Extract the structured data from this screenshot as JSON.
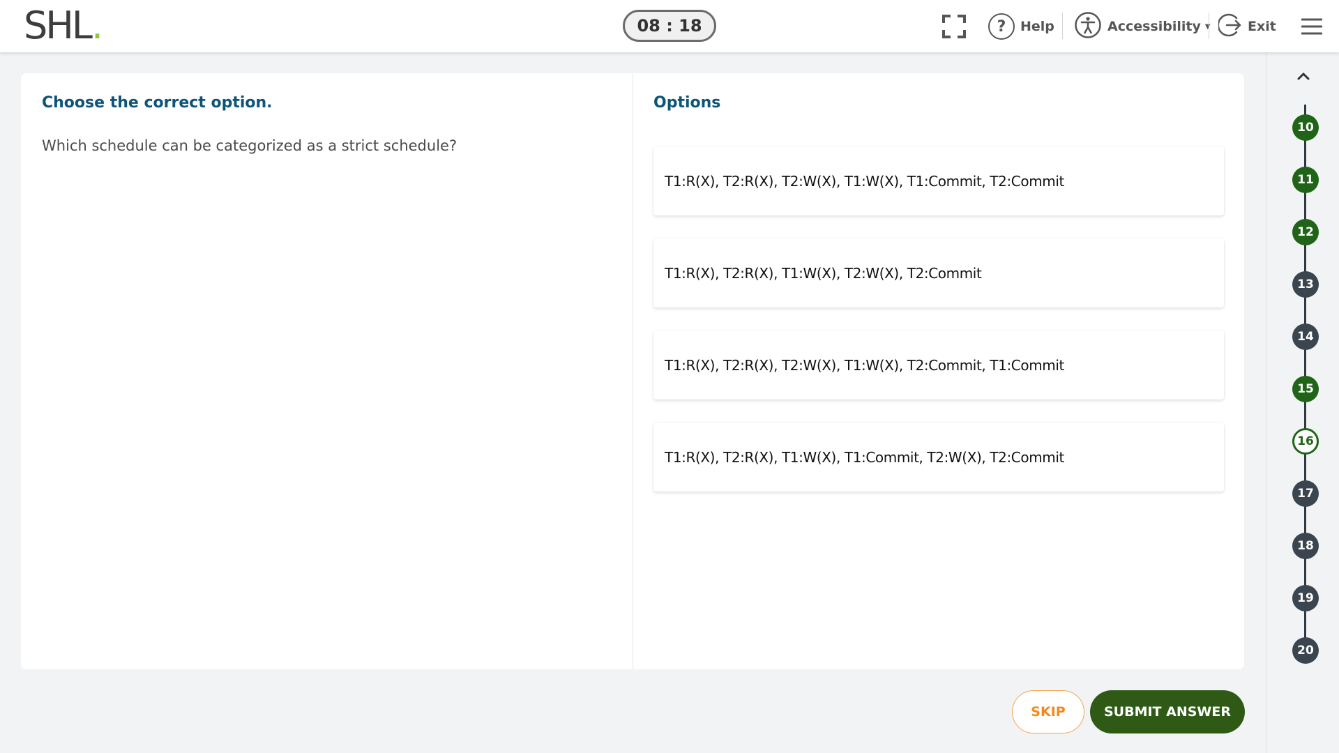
{
  "header": {
    "logo_text": "SHL",
    "logo_dot": ".",
    "timer": "08 : 18",
    "help_label": "Help",
    "accessibility_label": "Accessibility",
    "exit_label": "Exit",
    "icons": [
      "fullscreen-icon",
      "help-icon",
      "accessibility-icon",
      "exit-icon",
      "menu-icon"
    ]
  },
  "question": {
    "instruction": "Choose the correct option.",
    "text": "Which schedule can be categorized as a strict schedule?"
  },
  "options": {
    "heading": "Options",
    "items": [
      "T1:R(X), T2:R(X), T2:W(X), T1:W(X), T1:Commit, T2:Commit",
      "T1:R(X), T2:R(X), T1:W(X), T2:W(X), T2:Commit",
      "T1:R(X), T2:R(X), T2:W(X), T1:W(X), T2:Commit, T1:Commit",
      "T1:R(X), T2:R(X), T1:W(X), T1:Commit, T2:W(X), T2:Commit"
    ]
  },
  "actions": {
    "skip_label": "SKIP",
    "submit_label": "SUBMIT ANSWER"
  },
  "navigator": {
    "questions": [
      {
        "num": "10",
        "status": "done"
      },
      {
        "num": "11",
        "status": "done"
      },
      {
        "num": "12",
        "status": "done"
      },
      {
        "num": "13",
        "status": "pending"
      },
      {
        "num": "14",
        "status": "pending"
      },
      {
        "num": "15",
        "status": "done"
      },
      {
        "num": "16",
        "status": "current"
      },
      {
        "num": "17",
        "status": "pending"
      },
      {
        "num": "18",
        "status": "pending"
      },
      {
        "num": "19",
        "status": "pending"
      },
      {
        "num": "20",
        "status": "pending"
      }
    ]
  },
  "colors": {
    "brand_green": "#1f6417",
    "submit_green": "#2e5a16",
    "skip_orange": "#f08a1d",
    "heading_blue": "#0c5578",
    "logo_dot_green": "#8dc63f"
  }
}
